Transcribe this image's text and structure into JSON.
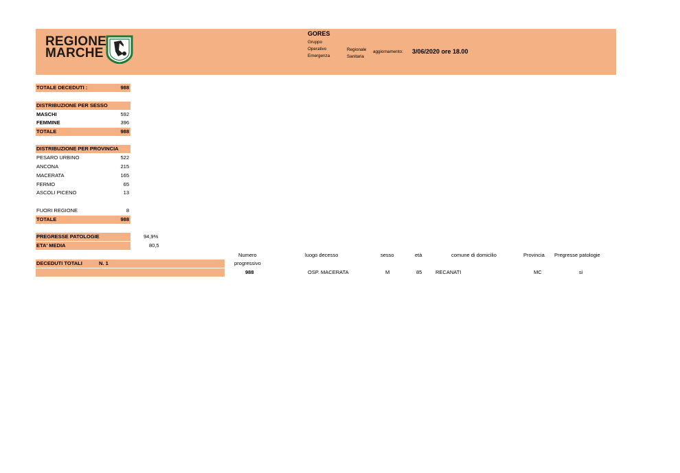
{
  "header": {
    "logo_line1": "REGIONE",
    "logo_line2": "MARCHE",
    "title": "GORES",
    "sub_lines": [
      "Gruppo",
      "Operativo",
      "Emergenza"
    ],
    "reg_lines": [
      "Regionale",
      "Sanitaria"
    ],
    "agg_label": "aggiornamento:",
    "agg_value": "3/06/2020 ore 18.00"
  },
  "totale_deceduti": {
    "label": "TOTALE DECEDUTI :",
    "value": "988"
  },
  "sesso": {
    "title": "DISTRIBUZIONE PER SESSO",
    "rows": [
      {
        "label": "MASCHI",
        "value": "592"
      },
      {
        "label": "FEMMINE",
        "value": "396"
      }
    ],
    "total": {
      "label": "TOTALE",
      "value": "988"
    }
  },
  "provincia": {
    "title": "DISTRIBUZIONE PER PROVINCIA",
    "rows": [
      {
        "label": "PESARO URBINO",
        "value": "522"
      },
      {
        "label": "ANCONA",
        "value": "215"
      },
      {
        "label": "MACERATA",
        "value": "165"
      },
      {
        "label": "FERMO",
        "value": "65"
      },
      {
        "label": "ASCOLI PICENO",
        "value": "13"
      }
    ],
    "fuori": {
      "label": "FUORI REGIONE",
      "value": "8"
    },
    "total": {
      "label": "TOTALE",
      "value": "988"
    }
  },
  "patologie": {
    "label": "PREGRESSE PATOLOGIE",
    "value": "94,9%"
  },
  "eta_media": {
    "label": "ETA' MEDIA",
    "value": "80,5"
  },
  "deceduti_totali": {
    "label": "DECEDUTI TOTALI",
    "n": "N.  1"
  },
  "table": {
    "headers": {
      "numero": "Numero",
      "progressivo": "progressivo",
      "luogo": "luogo decesso",
      "sesso": "sesso",
      "eta": "età",
      "comune": "comune di domicilio",
      "provincia": "Provincia",
      "patologie": "Pregresse patologie"
    },
    "row": {
      "numero": "988",
      "luogo": "OSP. MACERATA",
      "sesso": "M",
      "eta": "85",
      "comune": "RECANATI",
      "provincia": "MC",
      "patologie": "sì"
    }
  }
}
